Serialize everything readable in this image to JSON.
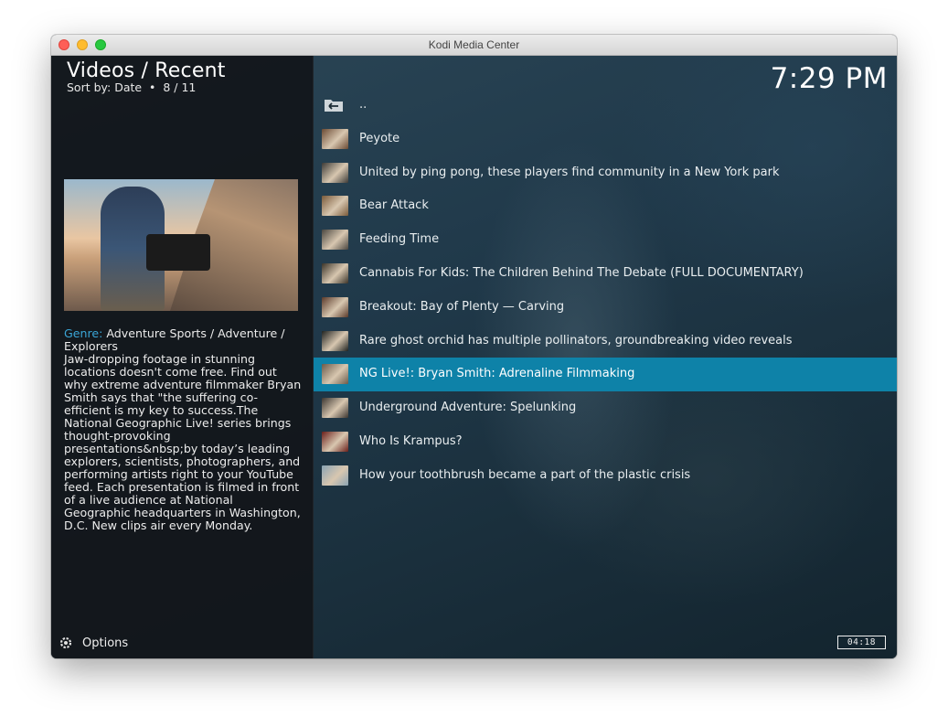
{
  "window": {
    "title": "Kodi Media Center"
  },
  "header": {
    "title": "Videos / Recent",
    "sort_text": "Sort by: Date  •  8 / 11"
  },
  "clock": "7:29 PM",
  "info": {
    "genre_label": "Genre:",
    "genre_value": "Adventure Sports / Adventure / Explorers",
    "description": "Jaw-dropping footage in stunning locations doesn't come free. Find out why extreme adventure filmmaker Bryan Smith says that \"the suffering co-efficient is my key to success.The National Geographic Live! series brings thought-provoking presentations&nbsp;by today’s leading explorers, scientists, photographers, and performing artists right to your YouTube feed. Each presentation is filmed in front of a live audience at National Geographic headquarters in Washington, D.C. New clips air every Monday."
  },
  "footer": {
    "options_label": "Options",
    "duration": "04:18"
  },
  "list": {
    "parent_label": "..",
    "items": [
      {
        "label": "Peyote",
        "thumb_color": "#6b4a33"
      },
      {
        "label": "United by ping pong, these players find community in a New York park",
        "thumb_color": "#3c3a36"
      },
      {
        "label": "Bear Attack",
        "thumb_color": "#7a5a3a"
      },
      {
        "label": "Feeding Time",
        "thumb_color": "#4a4640"
      },
      {
        "label": "Cannabis For Kids: The Children Behind The Debate (FULL DOCUMENTARY)",
        "thumb_color": "#3a3328"
      },
      {
        "label": "Breakout: Bay of Plenty — Carving",
        "thumb_color": "#5a3a2a"
      },
      {
        "label": "Rare ghost orchid has multiple pollinators, groundbreaking video reveals",
        "thumb_color": "#1f2220"
      },
      {
        "label": "NG Live!: Bryan Smith: Adrenaline Filmmaking",
        "thumb_color": "#6a5a4a"
      },
      {
        "label": "Underground Adventure: Spelunking",
        "thumb_color": "#3b3530"
      },
      {
        "label": "Who Is Krampus?",
        "thumb_color": "#6a1f1a"
      },
      {
        "label": "How your toothbrush became a part of the plastic crisis",
        "thumb_color": "#8aa3b3"
      }
    ],
    "selected_index": 7,
    "selected_color": "#0e82a8"
  },
  "icons": {
    "parent": "folder-back-icon",
    "options": "gear-icon"
  }
}
